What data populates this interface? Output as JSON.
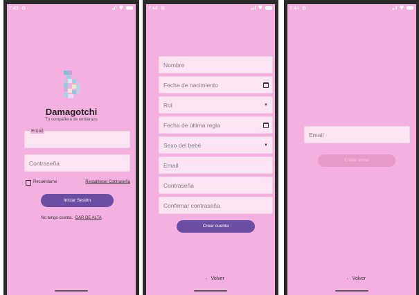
{
  "status": {
    "time1": "7:43",
    "time2": "7:44",
    "time3": "7:44"
  },
  "login": {
    "app_name": "Damagotchi",
    "tagline": "Tu compañera de embarazo",
    "email_placeholder": "Email",
    "password_placeholder": "Contraseña",
    "remember_label": "Recuérdame",
    "reset_link": "Restablecer Contraseña",
    "login_button": "Iniciar Sesión",
    "no_account_text": "No tengo cuenta.",
    "signup_link": "DAR DE ALTA"
  },
  "register": {
    "name_placeholder": "Nombre",
    "birthdate_placeholder": "Fecha de nacimiento",
    "role_placeholder": "Rol",
    "last_period_placeholder": "Fecha de última regla",
    "baby_sex_placeholder": "Sexo del bebé",
    "email_placeholder": "Email",
    "password_placeholder": "Contraseña",
    "confirm_password_placeholder": "Confirmar contraseña",
    "create_button": "Crear cuenta",
    "back_label": "Volver"
  },
  "recover": {
    "email_placeholder": "Email",
    "send_button": "Enviar email",
    "back_label": "Volver"
  },
  "colors": {
    "background": "#f4b0de",
    "field": "#fbe5f3",
    "primary_button": "#6a4ea3",
    "disabled_button": "#e89ac8"
  },
  "icons": [
    "gear-icon",
    "signal-icon",
    "wifi-icon",
    "battery-icon",
    "app-logo",
    "calendar-icon",
    "dropdown-arrow-icon",
    "checkbox-icon",
    "back-arrow-icon"
  ]
}
